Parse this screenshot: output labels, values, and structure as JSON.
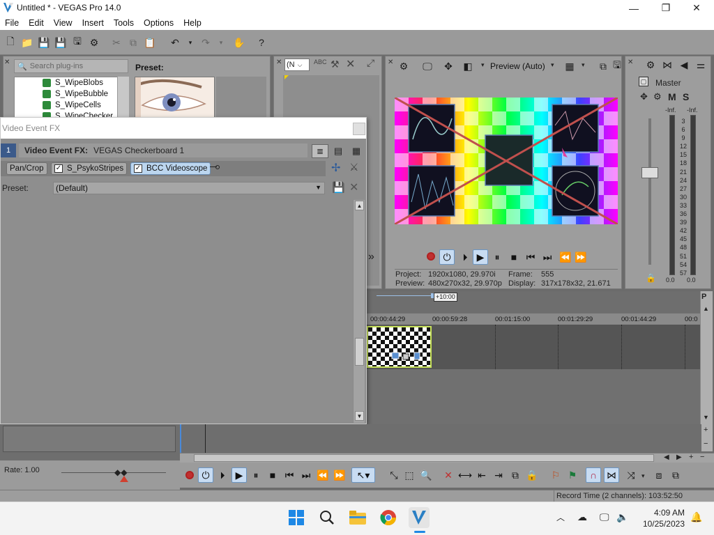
{
  "window": {
    "title": "Untitled * - VEGAS Pro 14.0",
    "minimize": "—",
    "maximize": "❐",
    "close": "✕"
  },
  "menu": [
    "File",
    "Edit",
    "View",
    "Insert",
    "Tools",
    "Options",
    "Help"
  ],
  "plugin_chooser": {
    "search_placeholder": "Search plug-ins",
    "items": [
      "S_WipeBlobs",
      "S_WipeBubble",
      "S_WipeCells",
      "S_WipeChecker"
    ],
    "preset_label": "Preset:"
  },
  "trimmer": {
    "dropdown_value": "(N"
  },
  "preview": {
    "quality_label": "Preview (Auto)",
    "project_label": "Project:",
    "project_value": "1920x1080, 29.970i",
    "frame_label": "Frame:",
    "frame_value": "555",
    "preview_label": "Preview:",
    "preview_value": "480x270x32, 29.970p",
    "display_label": "Display:",
    "display_value": "317x178x32, 21.671"
  },
  "master": {
    "label": "Master",
    "m_label": "M",
    "s_label": "S",
    "left_peak": "-Inf.",
    "right_peak": "-Inf.",
    "scale": [
      "3",
      "6",
      "9",
      "12",
      "15",
      "18",
      "21",
      "24",
      "27",
      "30",
      "33",
      "36",
      "39",
      "42",
      "45",
      "48",
      "51",
      "54",
      "57"
    ],
    "left_value": "0.0",
    "right_value": "0.0"
  },
  "fx_dialog": {
    "title": "Video Event FX",
    "index_badge": "1",
    "header_label": "Video Event FX:",
    "header_value": "VEGAS Checkerboard 1",
    "chain": [
      {
        "label": "Pan/Crop",
        "checkbox": false,
        "active": false
      },
      {
        "label": "S_PsykoStripes",
        "checkbox": true,
        "active": false
      },
      {
        "label": "BCC Videoscope",
        "checkbox": true,
        "active": true
      }
    ],
    "preset_label": "Preset:",
    "preset_value": "(Default)"
  },
  "timeline": {
    "zoom_label": "+10:00",
    "ticks": [
      "00:00:44:29",
      "00:00:59:28",
      "00:01:15:00",
      "00:01:29:29",
      "00:01:44:29",
      "00:0"
    ]
  },
  "rate": {
    "label": "Rate: 1.00"
  },
  "status": {
    "record_time": "Record Time (2 channels): 103:52:50"
  },
  "taskbar": {
    "time": "4:09 AM",
    "date": "10/25/2023"
  },
  "colors": {
    "accent": "#6b95c2",
    "clip_border": "#c6e05a"
  }
}
